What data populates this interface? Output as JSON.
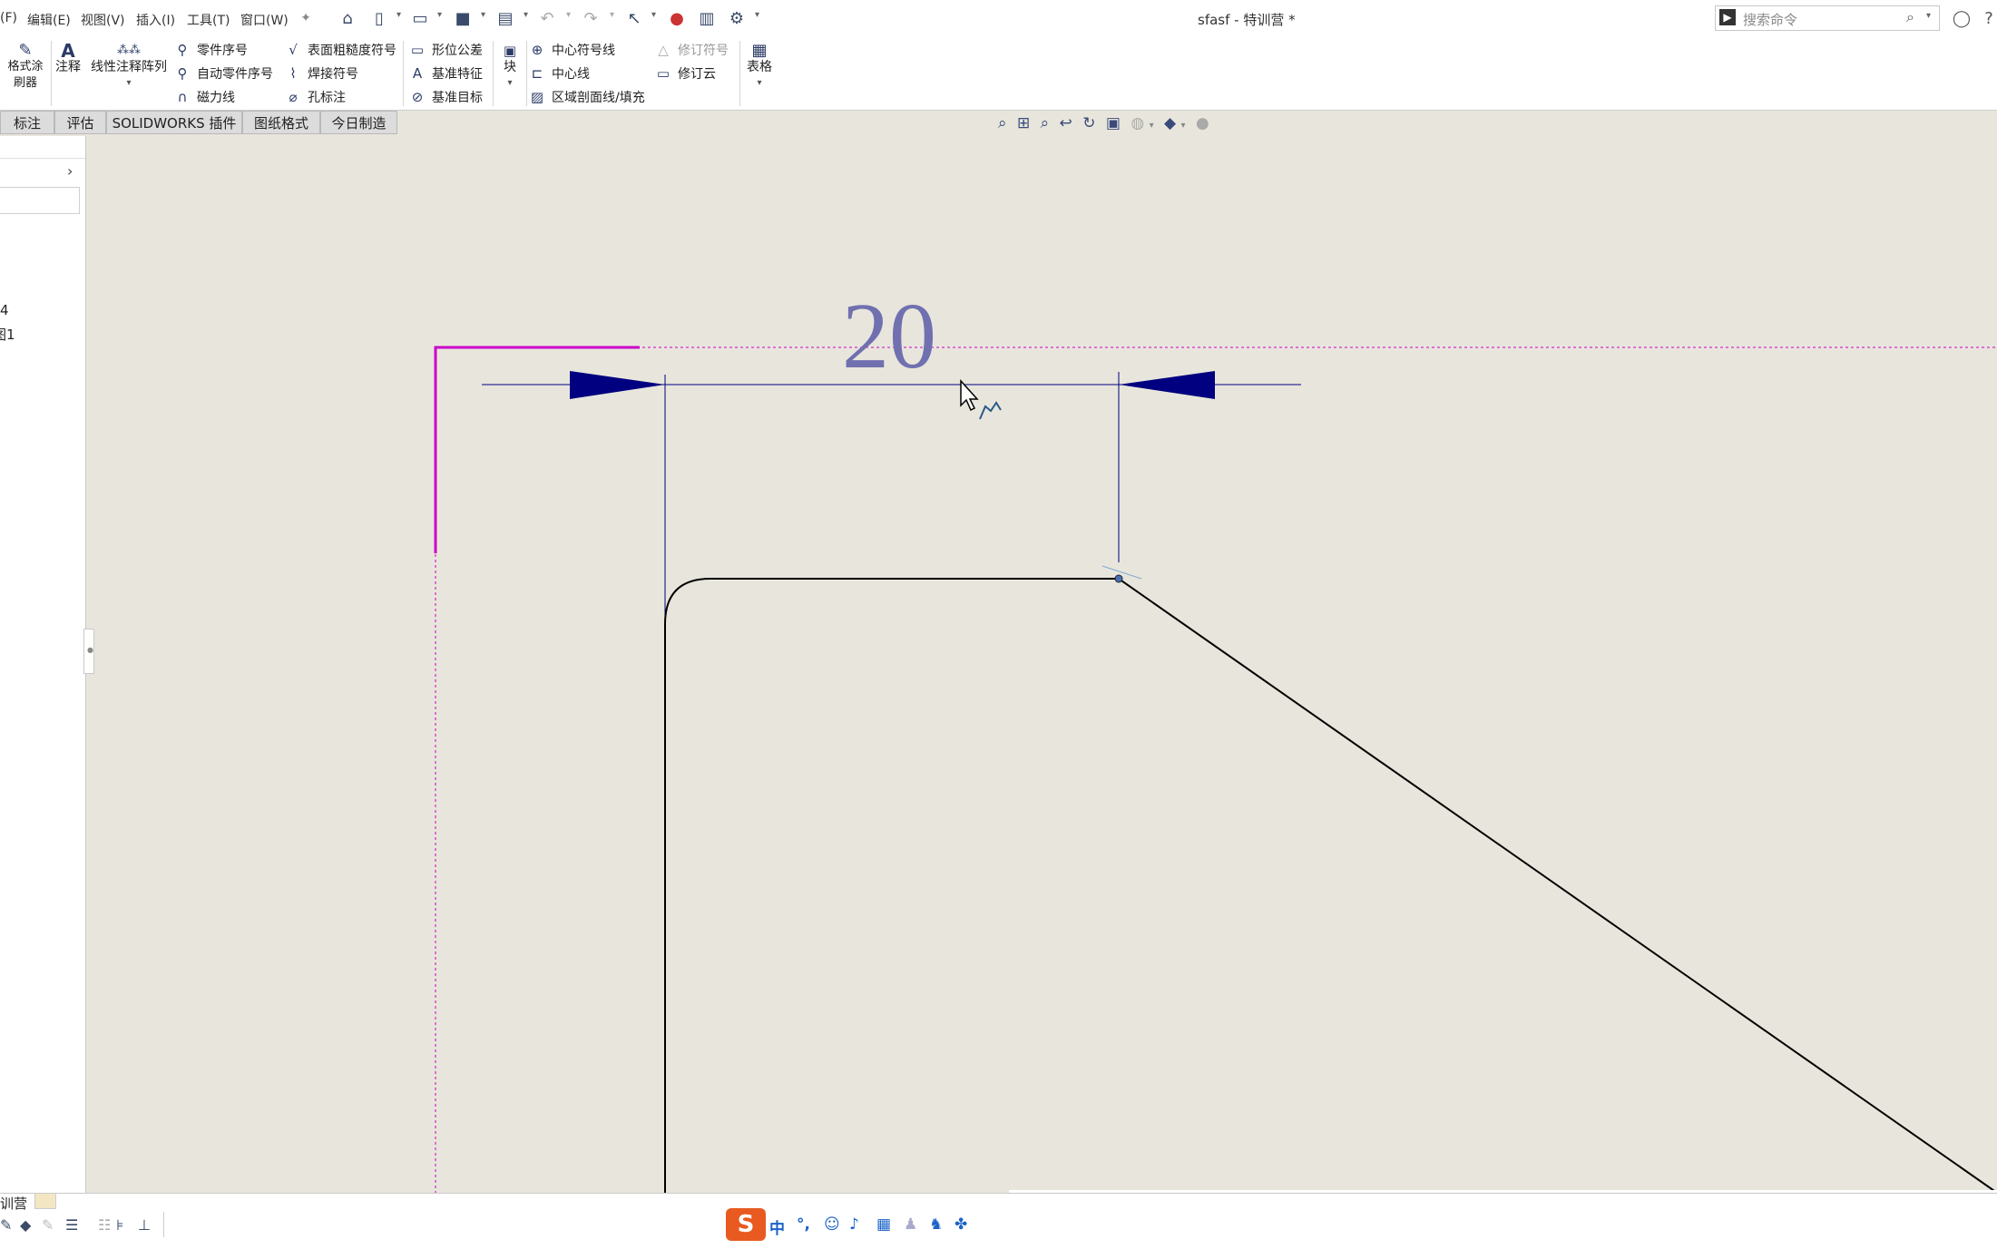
{
  "menubar": {
    "items": [
      "(F)",
      "编辑(E)",
      "视图(V)",
      "插入(I)",
      "工具(T)",
      "窗口(W)"
    ],
    "title": "sfasf - 特训营 *",
    "search_placeholder": "搜索命令"
  },
  "ribbon": {
    "format_painter": "格式涂刷器",
    "note": "注释",
    "linear_pattern": "线性注释阵列",
    "balloon": "零件序号",
    "auto_balloon": "自动零件序号",
    "magnetic_line": "磁力线",
    "surface_finish": "表面粗糙度符号",
    "weld_symbol": "焊接符号",
    "hole_callout": "孔标注",
    "gtol": "形位公差",
    "datum_feature": "基准特征",
    "datum_target": "基准目标",
    "block": "块",
    "center_mark": "中心符号线",
    "centerline": "中心线",
    "area_hatch": "区域剖面线/填充",
    "revision_symbol": "修订符号",
    "revision_cloud": "修订云",
    "table": "表格"
  },
  "tabs": [
    "标注",
    "评估",
    "SOLIDWORKS 插件",
    "图纸格式",
    "今日制造"
  ],
  "left_panel": {
    "item_1": "4",
    "item_2": "图1"
  },
  "drawing": {
    "dimension_value": "20"
  },
  "statusbar": {
    "tab_label": "训营",
    "ime_label": "中"
  },
  "colors": {
    "canvas": "#e8e6dc",
    "dimension_text": "#7070b0",
    "arrow_fill": "#000080",
    "border_magenta": "#cc00cc"
  }
}
